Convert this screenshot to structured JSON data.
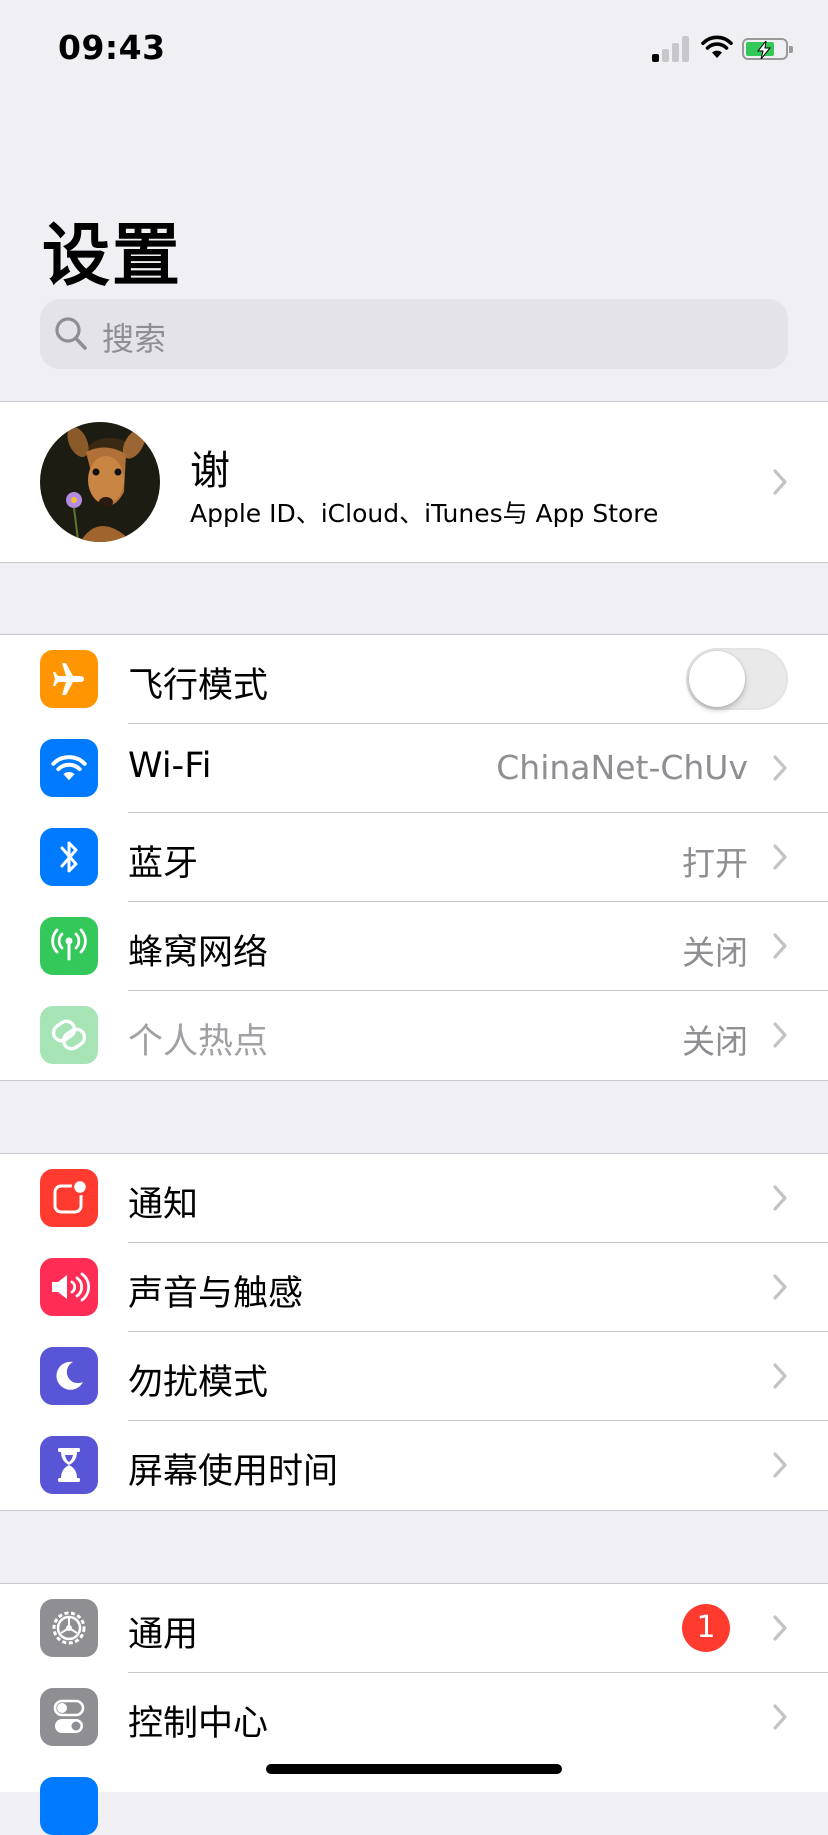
{
  "status_bar": {
    "time": "09:43"
  },
  "header": {
    "title": "设置"
  },
  "search": {
    "placeholder": "搜索"
  },
  "profile": {
    "name": "谢",
    "subtitle": "Apple ID、iCloud、iTunes与 App Store"
  },
  "group1": [
    {
      "label": "飞行模式",
      "icon": "airplane-icon",
      "icon_color": "#ff9500",
      "toggle": false
    },
    {
      "label": "Wi-Fi",
      "value": "ChinaNet-ChUv",
      "icon": "wifi-icon",
      "icon_color": "#007aff"
    },
    {
      "label": "蓝牙",
      "value": "打开",
      "icon": "bluetooth-icon",
      "icon_color": "#007aff"
    },
    {
      "label": "蜂窝网络",
      "value": "关闭",
      "icon": "cellular-icon",
      "icon_color": "#34c759"
    },
    {
      "label": "个人热点",
      "value": "关闭",
      "icon": "hotspot-icon",
      "icon_color": "#a6e4b6",
      "disabled": true
    }
  ],
  "group2": [
    {
      "label": "通知",
      "icon": "notifications-icon",
      "icon_color": "#ff3b30"
    },
    {
      "label": "声音与触感",
      "icon": "sound-icon",
      "icon_color": "#ff2d55"
    },
    {
      "label": "勿扰模式",
      "icon": "moon-icon",
      "icon_color": "#5856d6"
    },
    {
      "label": "屏幕使用时间",
      "icon": "hourglass-icon",
      "icon_color": "#5856d6"
    }
  ],
  "group3": [
    {
      "label": "通用",
      "badge": "1",
      "icon": "gear-icon",
      "icon_color": "#8e8e93"
    },
    {
      "label": "控制中心",
      "icon": "toggles-icon",
      "icon_color": "#8e8e93"
    }
  ]
}
